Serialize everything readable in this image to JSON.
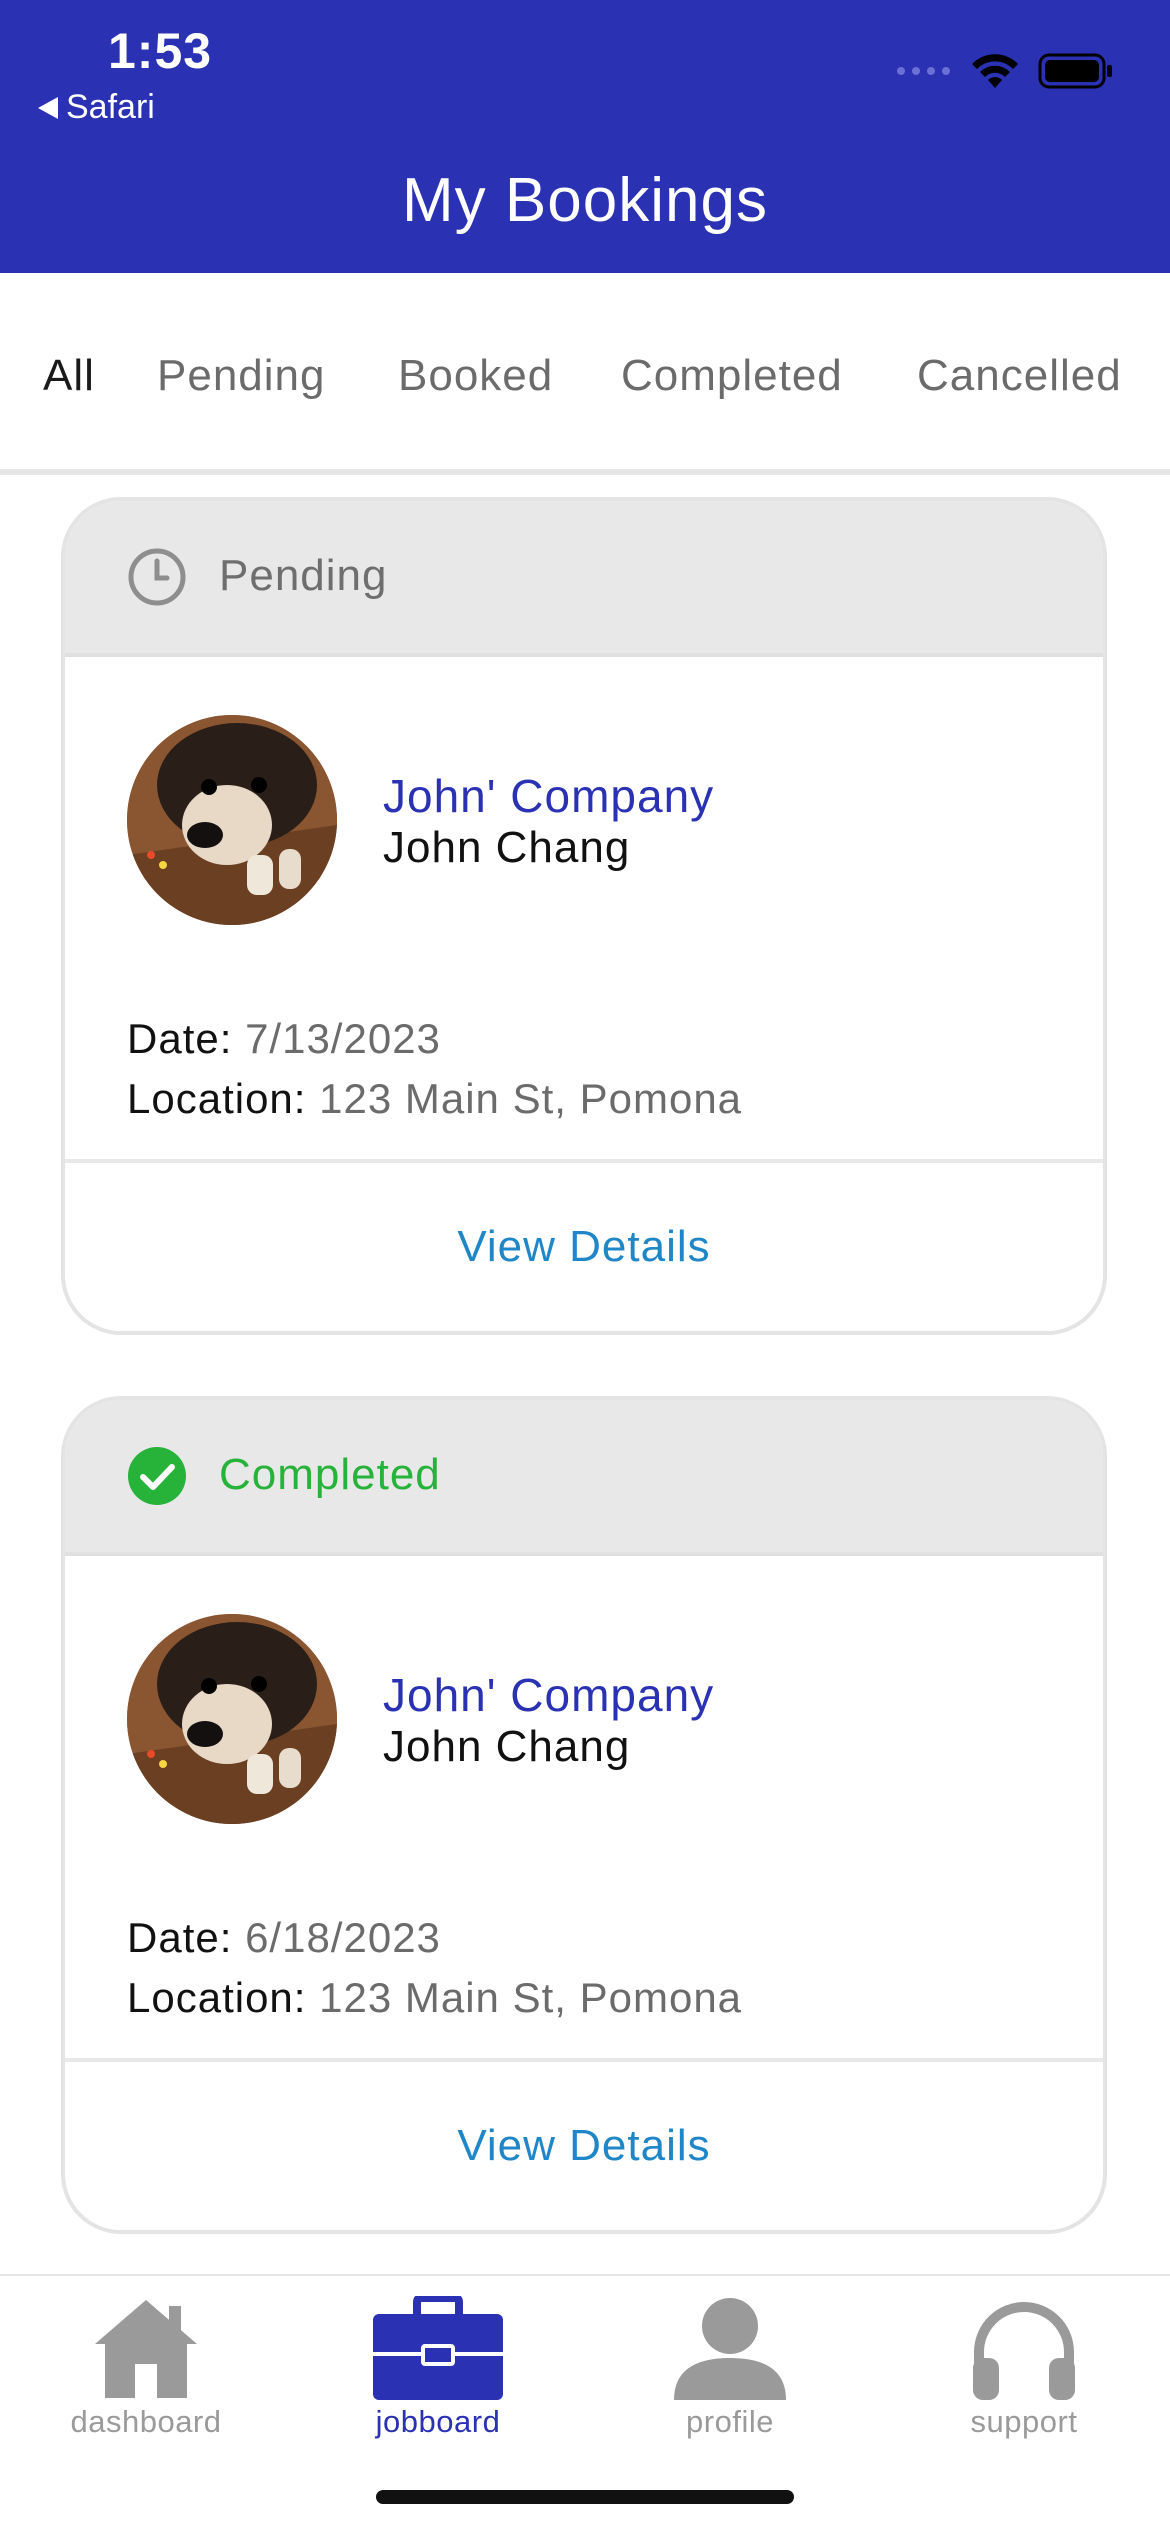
{
  "status_bar": {
    "time": "1:53",
    "back_label": "Safari"
  },
  "header": {
    "title": "My Bookings"
  },
  "tabs": [
    {
      "label": "All",
      "active": true
    },
    {
      "label": "Pending",
      "active": false
    },
    {
      "label": "Booked",
      "active": false
    },
    {
      "label": "Completed",
      "active": false
    },
    {
      "label": "Cancelled",
      "active": false
    }
  ],
  "bookings": [
    {
      "status": "Pending",
      "status_icon": "clock-icon",
      "status_color": "#6e6e6e",
      "company": "John' Company",
      "person": "John Chang",
      "date_label": "Date:",
      "date": "7/13/2023",
      "location_label": "Location:",
      "location": "123 Main St, Pomona",
      "action_label": "View Details"
    },
    {
      "status": "Completed",
      "status_icon": "check-circle-icon",
      "status_color": "#27b23a",
      "company": "John' Company",
      "person": "John Chang",
      "date_label": "Date:",
      "date": "6/18/2023",
      "location_label": "Location:",
      "location": "123 Main St, Pomona",
      "action_label": "View Details"
    }
  ],
  "bottom_nav": [
    {
      "label": "dashboard",
      "icon": "home-icon",
      "active": false
    },
    {
      "label": "jobboard",
      "icon": "briefcase-icon",
      "active": true
    },
    {
      "label": "profile",
      "icon": "person-icon",
      "active": false
    },
    {
      "label": "support",
      "icon": "headphones-icon",
      "active": false
    }
  ],
  "colors": {
    "primary": "#2a31b3",
    "link": "#1f86c8",
    "inactive": "#9a9a9a"
  }
}
